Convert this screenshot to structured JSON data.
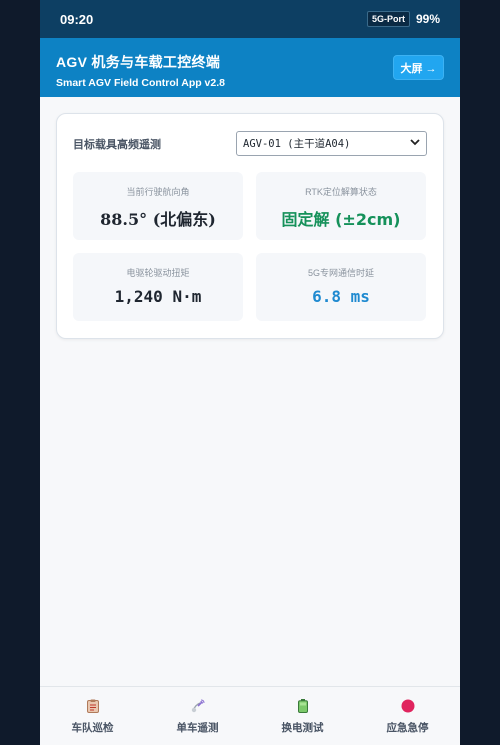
{
  "status_bar": {
    "time": "09:20",
    "network": "5G-Port",
    "battery": "99%"
  },
  "header": {
    "title": "AGV 机务与车载工控终端",
    "subtitle": "Smart AGV Field Control App v2.8",
    "big_screen_label": "大屏 →"
  },
  "telemetry": {
    "label": "目标载具高频遥测",
    "selected_device": "AGV-01 (主干道A04)",
    "tiles": [
      {
        "label": "当前行驶航向角",
        "value": "88.5° (北偏东)"
      },
      {
        "label": "RTK定位解算状态",
        "value": "固定解 (±2cm)"
      },
      {
        "label": "电驱轮驱动扭矩",
        "value": "1,240 N·m"
      },
      {
        "label": "5G专网通信时延",
        "value": "6.8 ms"
      }
    ]
  },
  "tabs": [
    {
      "label": "车队巡检",
      "icon": "clipboard-icon"
    },
    {
      "label": "单车遥测",
      "icon": "satellite-icon"
    },
    {
      "label": "换电测试",
      "icon": "battery-icon"
    },
    {
      "label": "应急急停",
      "icon": "stop-icon"
    }
  ],
  "colors": {
    "status_bar": "#0d3f63",
    "header": "#0d82c4",
    "accent_green": "#15915a",
    "accent_blue": "#1f8ad0",
    "stop_red": "#e0245e"
  }
}
